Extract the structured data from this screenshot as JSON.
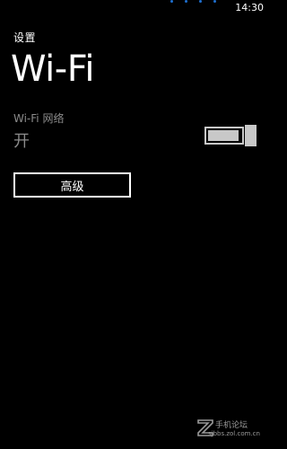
{
  "status_bar": {
    "time": "14:30",
    "signal_icon": "signal-strength-icon",
    "accent_color": "#1e6fd0"
  },
  "header": {
    "app_title": "设置",
    "page_title": "Wi-Fi"
  },
  "wifi": {
    "network_label": "Wi-Fi 网络",
    "state_text": "开",
    "toggle_on": true,
    "toggle_fill_fraction": 0.95
  },
  "advanced_button": {
    "label": "高级"
  },
  "watermark": {
    "title": "手机论坛",
    "url": "sjbbs.zol.com.cn"
  }
}
